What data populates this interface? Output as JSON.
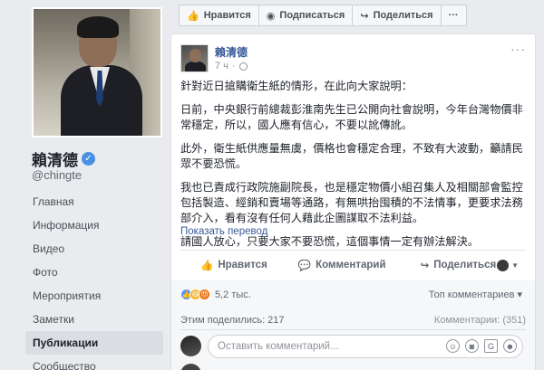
{
  "page": {
    "name": "賴清德",
    "username": "@chingte",
    "nav": [
      "Главная",
      "Информация",
      "Видео",
      "Фото",
      "Мероприятия",
      "Заметки",
      "Публикации",
      "Сообщество"
    ],
    "active_nav_index": 6
  },
  "topbar": {
    "like": "Нравится",
    "follow": "Подписаться",
    "share": "Поделиться",
    "more": "···"
  },
  "post": {
    "author": "賴清德",
    "time": "7 ч",
    "paragraphs": [
      "針對近日搶購衛生紙的情形，在此向大家說明：",
      "日前，中央銀行前總裁彭淮南先生已公開向社會說明，今年台灣物價非常穩定，所以，國人應有信心，不要以訛傳訛。",
      "此外，衛生紙供應量無虞，價格也會穩定合理，不致有大波動，籲請民眾不要恐慌。",
      "我也已責成行政院施副院長，也是穩定物價小組召集人及相關部會監控包括製造、經銷和賣場等通路，有無哄抬囤積的不法情事，更要求法務部介入，看有沒有任何人藉此企圖謀取不法利益。",
      "請國人放心，只要大家不要恐慌，這個事情一定有辦法解決。"
    ],
    "translate": "Показать перевод",
    "actions": {
      "like": "Нравится",
      "comment": "Комментарий",
      "share": "Поделиться"
    },
    "reactions_count": "5,2 тыс.",
    "top_comments": "Топ комментариев ▾",
    "shares": "Этим поделились: 217",
    "comments_count": "Комментарии: (351)",
    "comment_placeholder": "Оставить комментарий..."
  },
  "colors": {
    "link": "#365899",
    "background": "#e9ebee",
    "verified": "#4a90e2"
  }
}
